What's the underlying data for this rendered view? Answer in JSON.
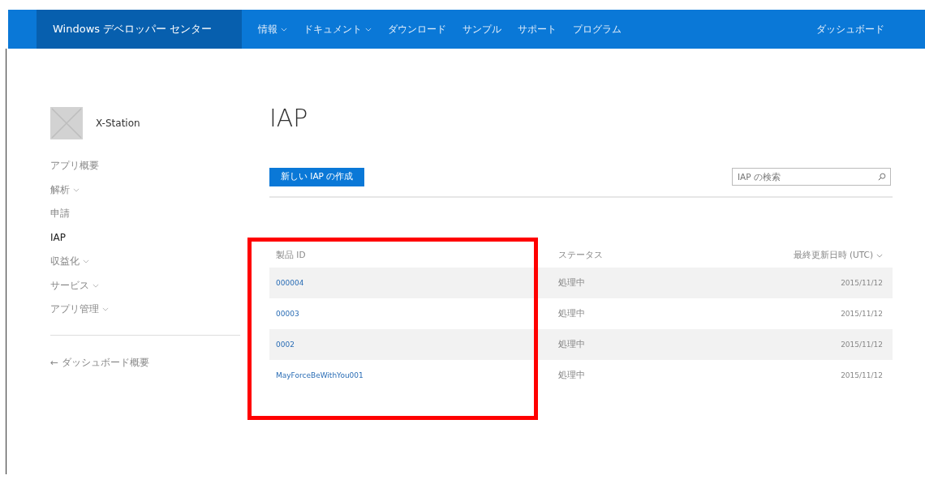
{
  "header": {
    "brand": "Windows デベロッパー センター",
    "nav": [
      {
        "label": "情報",
        "has_menu": true
      },
      {
        "label": "ドキュメント",
        "has_menu": true
      },
      {
        "label": "ダウンロード",
        "has_menu": false
      },
      {
        "label": "サンプル",
        "has_menu": false
      },
      {
        "label": "サポート",
        "has_menu": false
      },
      {
        "label": "プログラム",
        "has_menu": false
      }
    ],
    "dashboard_link": "ダッシュボード"
  },
  "sidebar": {
    "app_name": "X-Station",
    "items": [
      {
        "label": "アプリ概要",
        "has_menu": false,
        "selected": false
      },
      {
        "label": "解析",
        "has_menu": true,
        "selected": false
      },
      {
        "label": "申請",
        "has_menu": false,
        "selected": false
      },
      {
        "label": "IAP",
        "has_menu": false,
        "selected": true
      },
      {
        "label": "収益化",
        "has_menu": true,
        "selected": false
      },
      {
        "label": "サービス",
        "has_menu": true,
        "selected": false
      },
      {
        "label": "アプリ管理",
        "has_menu": true,
        "selected": false
      }
    ],
    "back_link": "← ダッシュボード概要"
  },
  "page": {
    "title": "IAP",
    "create_button": "新しい IAP の作成",
    "search": {
      "placeholder": "IAP の検索"
    }
  },
  "table": {
    "columns": [
      {
        "label": "製品 ID",
        "sortable": false
      },
      {
        "label": "ステータス",
        "sortable": false
      },
      {
        "label": "最終更新日時 (UTC)",
        "sortable": true
      }
    ],
    "rows": [
      {
        "product_id": "000004",
        "status": "処理中",
        "updated": "2015/11/12"
      },
      {
        "product_id": "00003",
        "status": "処理中",
        "updated": "2015/11/12"
      },
      {
        "product_id": "0002",
        "status": "処理中",
        "updated": "2015/11/12"
      },
      {
        "product_id": "MayForceBeWithYou001",
        "status": "処理中",
        "updated": "2015/11/12"
      }
    ]
  },
  "highlight": {
    "color": "#ff0000"
  }
}
